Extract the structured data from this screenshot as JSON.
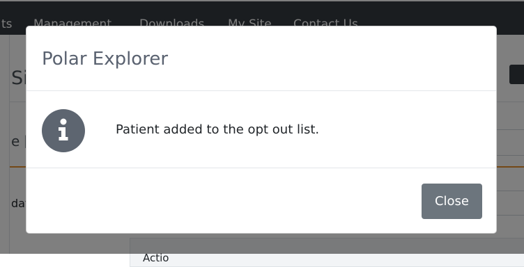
{
  "navbar": {
    "items": [
      "ts",
      "Management",
      "Downloads",
      "My Site",
      "Contact Us"
    ]
  },
  "page": {
    "site_heading": "Si",
    "section_heading": "e [",
    "row_label": "dat",
    "table_header": "Actio"
  },
  "modal": {
    "title": "Polar Explorer",
    "icon": "info-circle-icon",
    "message": "Patient added to the opt out list.",
    "close_label": "Close"
  },
  "colors": {
    "navbar_bg": "#343a40",
    "accent": "#e8912d",
    "button_secondary": "#6c757d",
    "icon_bg": "#5d6570"
  }
}
